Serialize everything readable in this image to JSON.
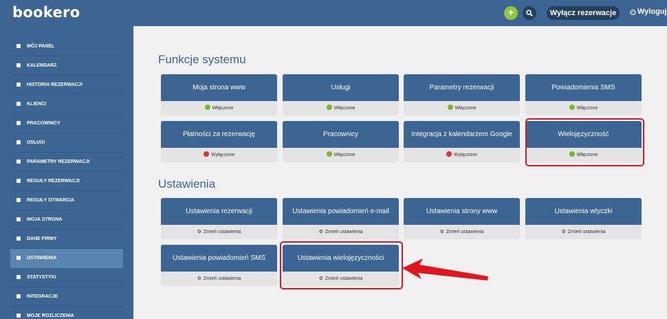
{
  "header": {
    "logo": "bookero",
    "add_label": "+",
    "toggle_label": "Wyłącz rezerwacje",
    "logout_label": "Wyloguj"
  },
  "sidebar": {
    "items": [
      {
        "label": "Mój panel",
        "icon": "dashboard-icon"
      },
      {
        "label": "Kalendarz",
        "icon": "calendar-icon"
      },
      {
        "label": "Historia rezerwacji",
        "icon": "history-icon"
      },
      {
        "label": "Klienci",
        "icon": "users-icon"
      },
      {
        "label": "Pracownicy",
        "icon": "employees-icon"
      },
      {
        "label": "Usługi",
        "icon": "services-icon"
      },
      {
        "label": "Parametry rezerwacji",
        "icon": "wrench-icon"
      },
      {
        "label": "Reguły rezerwacji",
        "icon": "rules-icon"
      },
      {
        "label": "Reguły otwarcia",
        "icon": "opening-icon"
      },
      {
        "label": "Moja strona",
        "icon": "page-icon"
      },
      {
        "label": "Dane firmy",
        "icon": "company-icon"
      },
      {
        "label": "Ustawienia",
        "icon": "gear-icon",
        "active": true
      },
      {
        "label": "Statystyki",
        "icon": "stats-icon"
      },
      {
        "label": "Integracje",
        "icon": "integrations-icon"
      },
      {
        "label": "Moje rozliczenia",
        "icon": "billing-icon"
      }
    ]
  },
  "functions": {
    "title": "Funkcje systemu",
    "cards": [
      {
        "label": "Moja strona www",
        "status": "Włączone",
        "status_color": "#7cb82f"
      },
      {
        "label": "Usługi",
        "status": "Włączone",
        "status_color": "#7cb82f"
      },
      {
        "label": "Parametry rezerwacji",
        "status": "Włączone",
        "status_color": "#7cb82f"
      },
      {
        "label": "Powiadomienia SMS",
        "status": "Włączone",
        "status_color": "#7cb82f"
      },
      {
        "label": "Płatności za rezerwację",
        "status": "Wyłączone",
        "status_color": "#d9382b"
      },
      {
        "label": "Pracownicy",
        "status": "Włączone",
        "status_color": "#7cb82f"
      },
      {
        "label": "Integracja z kalendarzem Google",
        "status": "Wyłączone",
        "status_color": "#d9382b"
      },
      {
        "label": "Wielojęzyczność",
        "status": "Włączone",
        "status_color": "#7cb82f"
      }
    ]
  },
  "settings": {
    "title": "Ustawienia",
    "cards": [
      {
        "label": "Ustawienia rezerwacji",
        "action": "Zmień ustawienia"
      },
      {
        "label": "Ustawienia powiadomień e-mail",
        "action": "Zmień ustawienia"
      },
      {
        "label": "Ustawienia strony www",
        "action": "Zmień ustawienia"
      },
      {
        "label": "Ustawienia wtyczki",
        "action": "Zmień ustawienia"
      },
      {
        "label": "Ustawienia powiadomień SMS",
        "action": "Zmień ustawienia"
      },
      {
        "label": "Ustawienia wielojęzyczności",
        "action": "Zmień ustawienia"
      }
    ]
  },
  "colors": {
    "primary": "#3d6593",
    "highlight": "#e0161e",
    "enabled": "#7cb82f",
    "disabled": "#d9382b"
  }
}
